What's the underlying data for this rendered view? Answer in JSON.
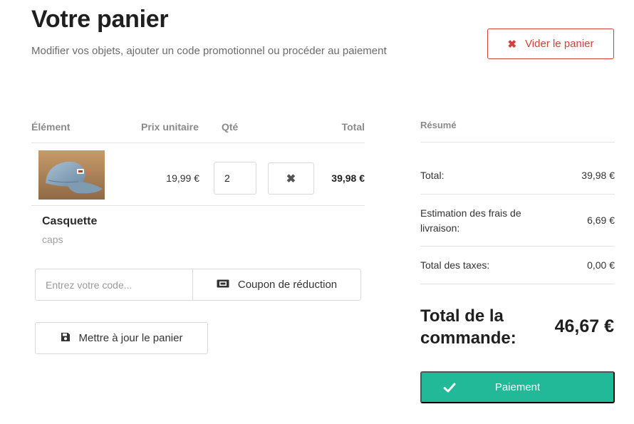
{
  "header": {
    "title": "Votre panier",
    "subtitle": "Modifier vos objets, ajouter un code promotionnel ou procéder au paiement",
    "empty_cart_label": "Vider le panier"
  },
  "cart": {
    "columns": {
      "item": "Élément",
      "unit_price": "Prix unitaire",
      "qty": "Qté",
      "total": "Total"
    },
    "items": [
      {
        "name": "Casquette",
        "category": "caps",
        "unit_price": "19,99 €",
        "quantity": "2",
        "line_total": "39,98 €",
        "image_icon": "cap-image"
      }
    ],
    "coupon": {
      "placeholder": "Entrez votre code...",
      "button_label": "Coupon de réduction"
    },
    "update_label": "Mettre à jour le panier"
  },
  "summary": {
    "heading": "Résumé",
    "rows": [
      {
        "label": "Total:",
        "value": "39,98 €"
      },
      {
        "label": "Estimation des frais de livraison:",
        "value": "6,69 €"
      },
      {
        "label": "Total des taxes:",
        "value": "0,00 €"
      }
    ],
    "grand_total_label": "Total de la commande:",
    "grand_total_value": "46,67 €",
    "checkout_label": "Paiement"
  },
  "colors": {
    "danger": "#d43f3a",
    "accent": "#21b997",
    "muted": "#8a8a8a"
  }
}
